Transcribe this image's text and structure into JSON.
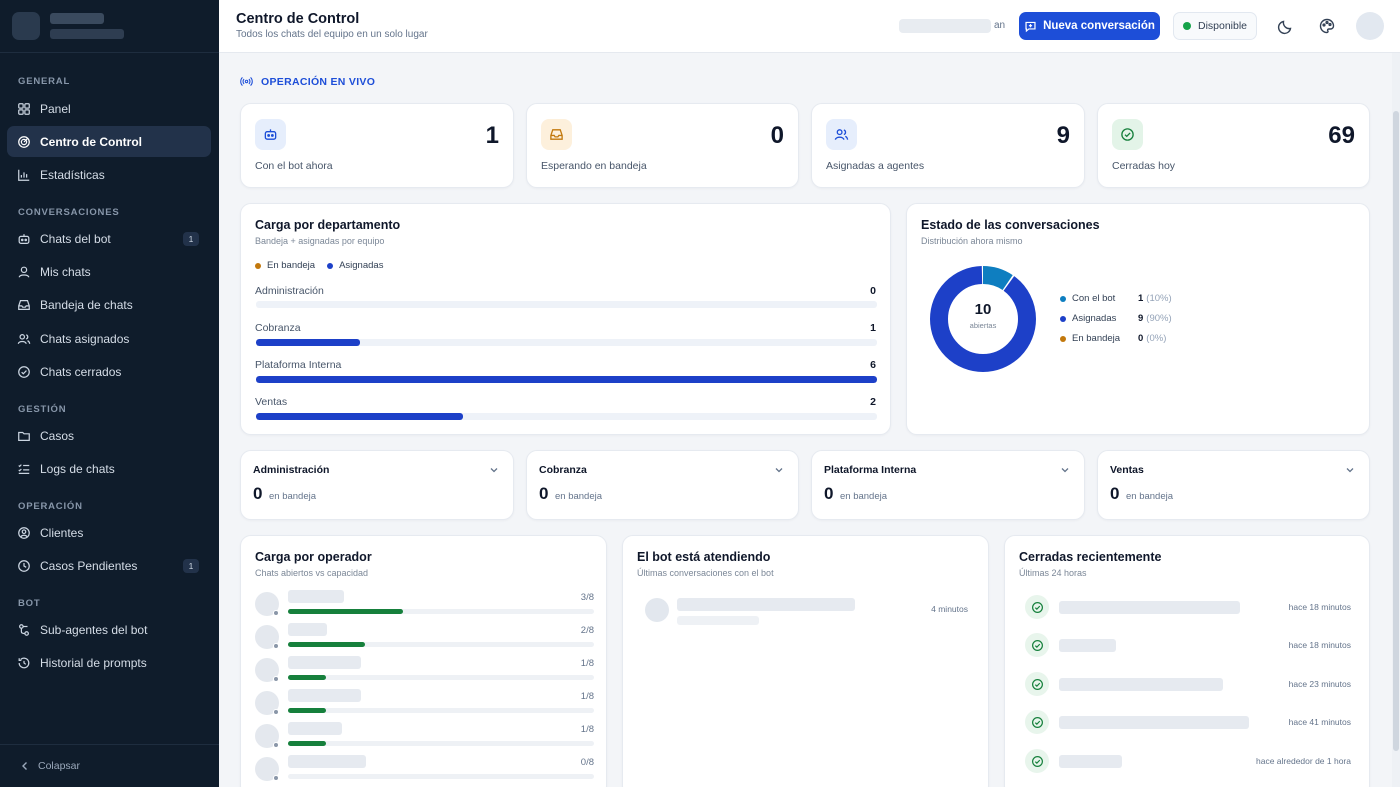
{
  "sidebar": {
    "sections": [
      "GENERAL",
      "CONVERSACIONES",
      "GESTIÓN",
      "OPERACIÓN",
      "BOT"
    ],
    "items": [
      {
        "label": "Panel",
        "icon": "grid-icon"
      },
      {
        "label": "Centro de Control",
        "icon": "radar-icon",
        "active": true
      },
      {
        "label": "Estadísticas",
        "icon": "bar-chart-icon"
      },
      {
        "label": "Chats del bot",
        "icon": "bot-icon",
        "badge": "1"
      },
      {
        "label": "Mis chats",
        "icon": "user-icon"
      },
      {
        "label": "Bandeja de chats",
        "icon": "inbox-icon"
      },
      {
        "label": "Chats asignados",
        "icon": "users-icon"
      },
      {
        "label": "Chats cerrados",
        "icon": "check-circle-icon"
      },
      {
        "label": "Casos",
        "icon": "folder-icon"
      },
      {
        "label": "Logs de chats",
        "icon": "list-check-icon"
      },
      {
        "label": "Clientes",
        "icon": "user-circle-icon"
      },
      {
        "label": "Casos Pendientes",
        "icon": "clock-icon",
        "badge": "1"
      },
      {
        "label": "Sub-agentes del bot",
        "icon": "sub-agents-icon"
      },
      {
        "label": "Historial de prompts",
        "icon": "history-icon"
      }
    ],
    "collapse_label": "Colapsar"
  },
  "topbar": {
    "title": "Centro de Control",
    "subtitle": "Todos los chats del equipo en un solo lugar",
    "user_suffix": "an",
    "new_conversation": "Nueva conversación",
    "status": "Disponible",
    "status_color": "#16a34a",
    "accent": "#1d4ed8"
  },
  "live_label": "OPERACIÓN EN VIVO",
  "stats": [
    {
      "value": "1",
      "label": "Con el bot ahora",
      "icon": "bot-icon",
      "bg": "#e6eefc",
      "color": "#1d4ed8"
    },
    {
      "value": "0",
      "label": "Esperando en bandeja",
      "icon": "inbox-icon",
      "bg": "#fdf0dc",
      "color": "#c2780c"
    },
    {
      "value": "9",
      "label": "Asignadas a agentes",
      "icon": "users-icon",
      "bg": "#e6eefc",
      "color": "#1d4ed8"
    },
    {
      "value": "69",
      "label": "Cerradas hoy",
      "icon": "check-circle-icon",
      "bg": "#e3f4e8",
      "color": "#16803c"
    }
  ],
  "dept_load": {
    "title": "Carga por departamento",
    "subtitle": "Bandeja + asignadas por equipo",
    "legend": [
      {
        "label": "En bandeja",
        "color": "#c2780c"
      },
      {
        "label": "Asignadas",
        "color": "#1d40c8"
      }
    ],
    "rows": [
      {
        "name": "Administración",
        "value": 0
      },
      {
        "name": "Cobranza",
        "value": 1
      },
      {
        "name": "Plataforma Interna",
        "value": 6
      },
      {
        "name": "Ventas",
        "value": 2
      }
    ],
    "max": 6
  },
  "conv_status": {
    "title": "Estado de las conversaciones",
    "subtitle": "Distribución ahora mismo",
    "center_value": "10",
    "center_label": "abiertas",
    "items": [
      {
        "name": "Con el bot",
        "value": "1",
        "pct": "(10%)",
        "fraction": 0.1,
        "color": "#0e7ec0"
      },
      {
        "name": "Asignadas",
        "value": "9",
        "pct": "(90%)",
        "fraction": 0.9,
        "color": "#1d40c8"
      },
      {
        "name": "En bandeja",
        "value": "0",
        "pct": "(0%)",
        "fraction": 0,
        "color": "#c2780c"
      }
    ]
  },
  "dept_cards": [
    {
      "name": "Administración",
      "value": "0",
      "label": "en bandeja"
    },
    {
      "name": "Cobranza",
      "value": "0",
      "label": "en bandeja"
    },
    {
      "name": "Plataforma Interna",
      "value": "0",
      "label": "en bandeja"
    },
    {
      "name": "Ventas",
      "value": "0",
      "label": "en bandeja"
    }
  ],
  "operator_load": {
    "title": "Carga por operador",
    "subtitle": "Chats abiertos vs capacidad",
    "rows": [
      {
        "ratio": "3/8",
        "fraction": 0.375
      },
      {
        "ratio": "2/8",
        "fraction": 0.25
      },
      {
        "ratio": "1/8",
        "fraction": 0.125
      },
      {
        "ratio": "1/8",
        "fraction": 0.125
      },
      {
        "ratio": "1/8",
        "fraction": 0.125
      },
      {
        "ratio": "0/8",
        "fraction": 0
      }
    ]
  },
  "bot_attending": {
    "title": "El bot está atendiendo",
    "subtitle": "Últimas conversaciones con el bot",
    "items": [
      {
        "time": "4 minutos"
      }
    ]
  },
  "recently_closed": {
    "title": "Cerradas recientemente",
    "subtitle": "Últimas 24 horas",
    "items": [
      {
        "time": "hace 18 minutos"
      },
      {
        "time": "hace 18 minutos"
      },
      {
        "time": "hace 23 minutos"
      },
      {
        "time": "hace 41 minutos"
      },
      {
        "time": "hace alrededor de 1 hora"
      }
    ]
  }
}
